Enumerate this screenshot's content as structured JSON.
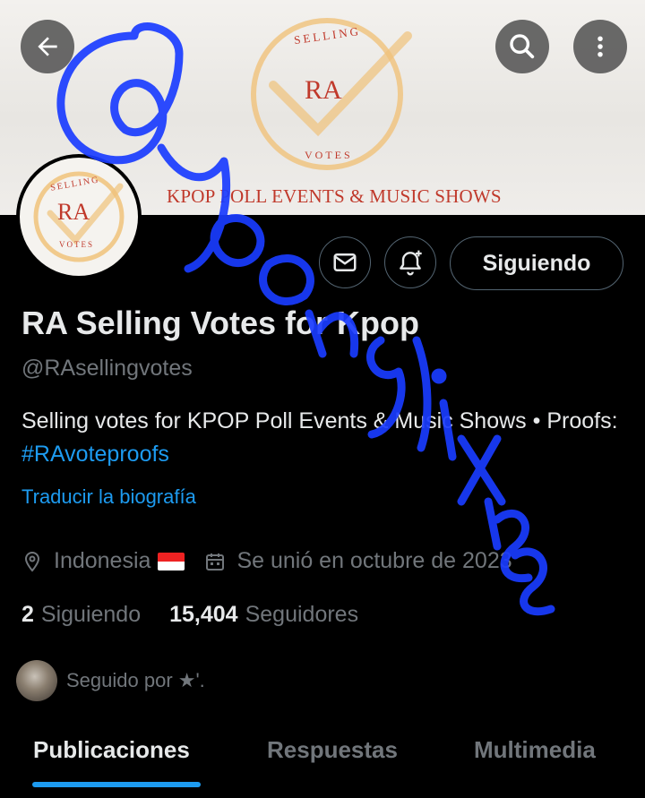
{
  "banner": {
    "logo_top_text": "SELLING",
    "logo_center_text": "RA",
    "logo_bottom_text": "VOTES",
    "tagline": "KPOP POLL EVENTS & MUSIC SHOWS"
  },
  "header": {
    "back_icon": "arrow-left-icon",
    "search_icon": "search-icon",
    "more_icon": "more-vertical-icon"
  },
  "avatar": {
    "top_text": "SELLING",
    "center_text": "RA",
    "bottom_text": "VOTES"
  },
  "actions": {
    "message_icon": "mail-icon",
    "notify_icon": "bell-plus-icon",
    "follow_label": "Siguiendo"
  },
  "profile": {
    "name": "RA Selling Votes for Kpop",
    "handle": "@RAsellingvotes",
    "bio_text": "Selling votes for KPOP Poll Events & Music Shows • Proofs: ",
    "bio_hashtag": "#RAvoteproofs",
    "translate_link": "Traducir la biografía",
    "location": "Indonesia",
    "joined": "Se unió en octubre de 2023",
    "following_count": "2",
    "following_label": "Siguiendo",
    "followers_count": "15,404",
    "followers_label": "Seguidores",
    "followed_by": "Seguido por ★'."
  },
  "tabs": [
    {
      "label": "Publicaciones",
      "active": true
    },
    {
      "label": "Respuestas",
      "active": false
    },
    {
      "label": "Multimedia",
      "active": false
    }
  ],
  "watermark": {
    "text": "@yoonglixiee",
    "color": "#1a3cff"
  },
  "colors": {
    "accent": "#1d9bf0",
    "background": "#000000",
    "text_primary": "#e7e9ea",
    "text_secondary": "#71767b",
    "logo_red": "#c0392b",
    "logo_gold": "#f0c27a"
  }
}
